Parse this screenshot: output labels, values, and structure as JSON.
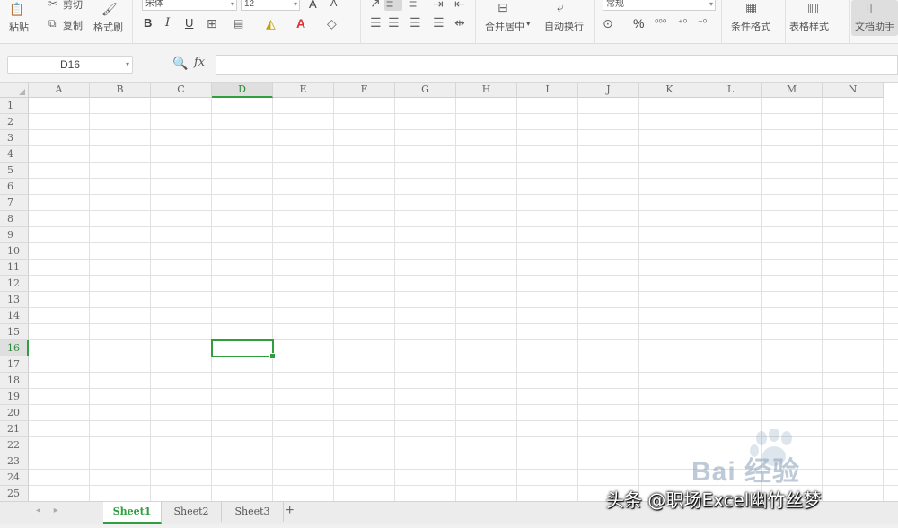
{
  "ribbon": {
    "paste_label": "粘贴",
    "cut_label": "剪切",
    "copy_label": "复制",
    "format_painter_label": "格式刷",
    "font_name": "宋体",
    "font_size": "12",
    "grow_font": "A",
    "shrink_font": "A",
    "bold": "B",
    "italic": "I",
    "underline": "U",
    "merge_center_label": "合并居中",
    "wrap_text_label": "自动换行",
    "number_format": "常规",
    "percent": "%",
    "cond_format_label": "条件格式",
    "table_style_label": "表格样式",
    "docs_assist_label": "文档助手"
  },
  "formula_bar": {
    "name_box": "D16",
    "fx_label": "fx",
    "formula_value": ""
  },
  "grid": {
    "columns": [
      "A",
      "B",
      "C",
      "D",
      "E",
      "F",
      "G",
      "H",
      "I",
      "J",
      "K",
      "L",
      "M",
      "N"
    ],
    "selected_column": "D",
    "rows": [
      "1",
      "2",
      "3",
      "4",
      "5",
      "6",
      "7",
      "8",
      "9",
      "10",
      "11",
      "12",
      "13",
      "14",
      "15",
      "16",
      "17",
      "18",
      "19",
      "20",
      "21",
      "22",
      "23",
      "24",
      "25"
    ],
    "selected_row": "16",
    "active_cell": "D16"
  },
  "sheets": {
    "tabs": [
      "Sheet1",
      "Sheet2",
      "Sheet3"
    ],
    "active": "Sheet1",
    "add_symbol": "+"
  },
  "overlay": {
    "watermark": "Bai 经验",
    "credit": "头条 @职场Excel幽竹丝梦"
  },
  "colors": {
    "accent": "#2e9e3e",
    "ribbon_bg": "#f7f7f7",
    "grid_line": "#e1e1e1"
  }
}
